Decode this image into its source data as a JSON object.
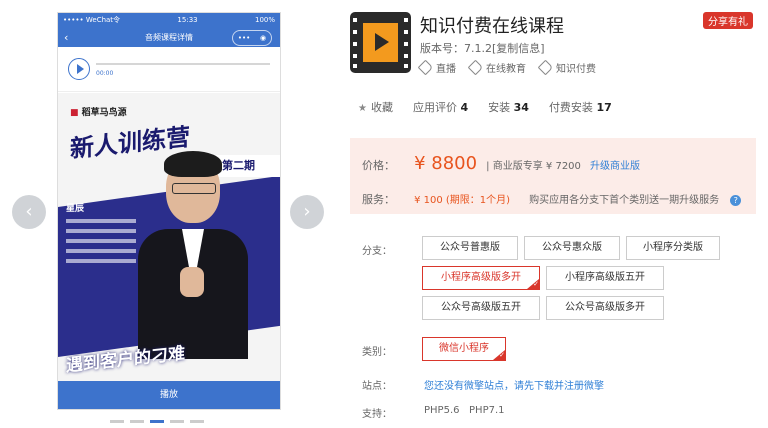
{
  "phone": {
    "status_left": "••••• WeChat令",
    "status_time": "15:33",
    "status_right": "100%",
    "nav_title": "音频课程详情",
    "player_time": "00:00",
    "brand": "稻草马鸟源",
    "poster_title": "新人训练营",
    "poster_banner": "第二期",
    "speaker": "星辰",
    "slogan": "遇到客户的刁难",
    "play_label": "播放"
  },
  "app": {
    "title": "知识付费在线课程",
    "version": "版本号：7.1.2[复制信息]",
    "tags": [
      "直播",
      "在线教育",
      "知识付费"
    ],
    "share_label": "分享有礼"
  },
  "stats": {
    "favorite": "收藏",
    "rating_label": "应用评价",
    "rating_value": "4",
    "install_label": "安装",
    "install_value": "34",
    "paid_label": "付费安装",
    "paid_value": "17"
  },
  "pricing": {
    "price_label": "价格：",
    "price": "¥ 8800",
    "biz_text": "商业版专享 ¥ 7200",
    "upgrade": "升级商业版",
    "service_label": "服务：",
    "service_value": "¥ 100 (期限：1个月)",
    "service_note": "购买应用各分支下首个类别送一期升级服务"
  },
  "branches": {
    "label": "分支：",
    "options": [
      "公众号普惠版",
      "公众号惠众版",
      "小程序分类版",
      "小程序高级版多开",
      "小程序高级版五开",
      "公众号高级版五开",
      "公众号高级版多开"
    ],
    "selected": "小程序高级版多开"
  },
  "category": {
    "label": "类别：",
    "value": "微信小程序"
  },
  "site": {
    "label": "站点：",
    "text": "您还没有微擎站点，请先下载并注册微擎"
  },
  "support": {
    "label": "支持：",
    "value": "PHP5.6   PHP7.1"
  },
  "colors": {
    "accent": "#3d73cc",
    "price": "#e8541e",
    "selected": "#d9362b",
    "link": "#2f7fd6",
    "price_bg": "#fcece8"
  }
}
